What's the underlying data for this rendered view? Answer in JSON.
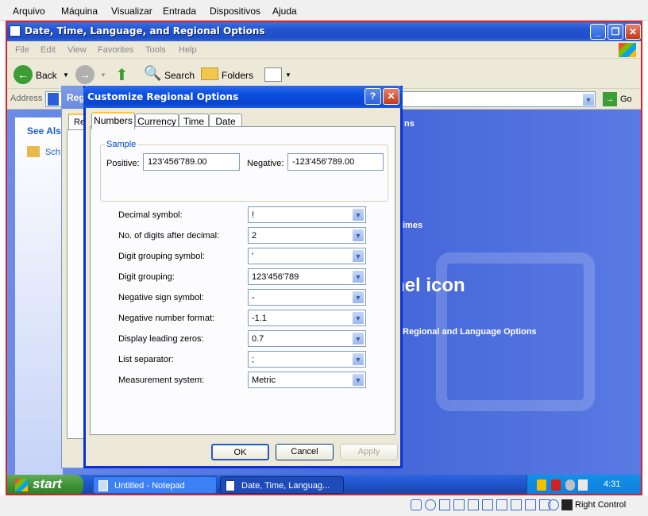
{
  "host_menu": {
    "items": [
      "Arquivo",
      "Máquina",
      "Visualizar",
      "Entrada",
      "Dispositivos",
      "Ajuda"
    ]
  },
  "explorer": {
    "title": "Date, Time, Language, and Regional Options",
    "menu": [
      "File",
      "Edit",
      "View",
      "Favorites",
      "Tools",
      "Help"
    ],
    "toolbar": {
      "back": "Back",
      "search": "Search",
      "folders": "Folders"
    },
    "address_label": "Address",
    "address_value": "Reg",
    "go": "Go",
    "see_also": "See Als",
    "left_item": "Sch",
    "heading_fragment": "ns",
    "times_fragment": "imes",
    "icon_text": "nel icon",
    "link_text": "Regional and Language Options"
  },
  "dialog": {
    "title": "Customize Regional Options",
    "tabs": [
      "Numbers",
      "Currency",
      "Time",
      "Date"
    ],
    "active_tab": "Numbers",
    "back_tab_label": "Re",
    "sample": {
      "label": "Sample",
      "positive_label": "Positive:",
      "positive_value": "123'456'789.00",
      "negative_label": "Negative:",
      "negative_value": "-123'456'789.00"
    },
    "fields": [
      {
        "label": "Decimal symbol:",
        "value": "!"
      },
      {
        "label": "No. of digits after decimal:",
        "value": "2"
      },
      {
        "label": "Digit grouping symbol:",
        "value": "'"
      },
      {
        "label": "Digit grouping:",
        "value": "123'456'789"
      },
      {
        "label": "Negative sign symbol:",
        "value": "-"
      },
      {
        "label": "Negative number format:",
        "value": "-1.1"
      },
      {
        "label": "Display leading zeros:",
        "value": "0.7"
      },
      {
        "label": "List separator:",
        "value": ";"
      },
      {
        "label": "Measurement system:",
        "value": "Metric"
      }
    ],
    "buttons": {
      "ok": "OK",
      "cancel": "Cancel",
      "apply": "Apply"
    }
  },
  "taskbar": {
    "start": "start",
    "items": [
      "Untitled - Notepad",
      "Date, Time, Languag..."
    ],
    "clock": "4:31"
  },
  "host_status": {
    "right_control": "Right Control"
  },
  "colors": {
    "accent": "#0831d9",
    "frame": "#e02020",
    "desktop": "#4466d9"
  }
}
